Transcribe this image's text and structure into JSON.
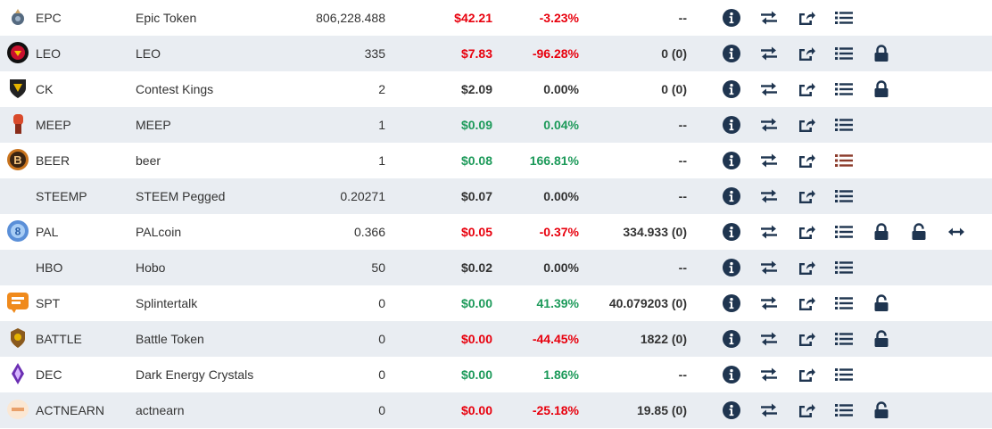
{
  "colors": {
    "up": "#1d9a5a",
    "down": "#e8000d",
    "icon": "#1f3550",
    "beer_list": "#8b3a2a"
  },
  "rows": [
    {
      "symbol": "EPC",
      "name": "Epic Token",
      "balance": "806,228.488",
      "price": "$42.21",
      "price_dir": "down",
      "change": "-3.23%",
      "change_dir": "down",
      "stake": "--",
      "lock": false,
      "unlock": false,
      "delegate": false,
      "logo": "epc-logo"
    },
    {
      "symbol": "LEO",
      "name": "LEO",
      "balance": "335",
      "price": "$7.83",
      "price_dir": "down",
      "change": "-96.28%",
      "change_dir": "down",
      "stake": "0 (0)",
      "lock": true,
      "unlock": false,
      "delegate": false,
      "logo": "leo-logo"
    },
    {
      "symbol": "CK",
      "name": "Contest Kings",
      "balance": "2",
      "price": "$2.09",
      "price_dir": "neutral",
      "change": "0.00%",
      "change_dir": "neutral",
      "stake": "0 (0)",
      "lock": true,
      "unlock": false,
      "delegate": false,
      "logo": "ck-logo"
    },
    {
      "symbol": "MEEP",
      "name": "MEEP",
      "balance": "1",
      "price": "$0.09",
      "price_dir": "up",
      "change": "0.04%",
      "change_dir": "up",
      "stake": "--",
      "lock": false,
      "unlock": false,
      "delegate": false,
      "logo": "meep-logo"
    },
    {
      "symbol": "BEER",
      "name": "beer",
      "balance": "1",
      "price": "$0.08",
      "price_dir": "up",
      "change": "166.81%",
      "change_dir": "up",
      "stake": "--",
      "lock": false,
      "unlock": false,
      "delegate": false,
      "logo": "beer-logo"
    },
    {
      "symbol": "STEEMP",
      "name": "STEEM Pegged",
      "balance": "0.20271",
      "price": "$0.07",
      "price_dir": "neutral",
      "change": "0.00%",
      "change_dir": "neutral",
      "stake": "--",
      "lock": false,
      "unlock": false,
      "delegate": false,
      "logo": ""
    },
    {
      "symbol": "PAL",
      "name": "PALcoin",
      "balance": "0.366",
      "price": "$0.05",
      "price_dir": "down",
      "change": "-0.37%",
      "change_dir": "down",
      "stake": "334.933 (0)",
      "lock": true,
      "unlock": true,
      "delegate": true,
      "logo": "pal-logo"
    },
    {
      "symbol": "HBO",
      "name": "Hobo",
      "balance": "50",
      "price": "$0.02",
      "price_dir": "neutral",
      "change": "0.00%",
      "change_dir": "neutral",
      "stake": "--",
      "lock": false,
      "unlock": false,
      "delegate": false,
      "logo": ""
    },
    {
      "symbol": "SPT",
      "name": "Splintertalk",
      "balance": "0",
      "price": "$0.00",
      "price_dir": "up",
      "change": "41.39%",
      "change_dir": "up",
      "stake": "40.079203 (0)",
      "lock": false,
      "unlock": true,
      "delegate": false,
      "logo": "spt-logo"
    },
    {
      "symbol": "BATTLE",
      "name": "Battle Token",
      "balance": "0",
      "price": "$0.00",
      "price_dir": "down",
      "change": "-44.45%",
      "change_dir": "down",
      "stake": "1822 (0)",
      "lock": false,
      "unlock": true,
      "delegate": false,
      "logo": "battle-logo"
    },
    {
      "symbol": "DEC",
      "name": "Dark Energy Crystals",
      "balance": "0",
      "price": "$0.00",
      "price_dir": "up",
      "change": "1.86%",
      "change_dir": "up",
      "stake": "--",
      "lock": false,
      "unlock": false,
      "delegate": false,
      "logo": "dec-logo"
    },
    {
      "symbol": "ACTNEARN",
      "name": "actnearn",
      "balance": "0",
      "price": "$0.00",
      "price_dir": "down",
      "change": "-25.18%",
      "change_dir": "down",
      "stake": "19.85 (0)",
      "lock": false,
      "unlock": true,
      "delegate": false,
      "logo": "actnearn-logo"
    }
  ]
}
